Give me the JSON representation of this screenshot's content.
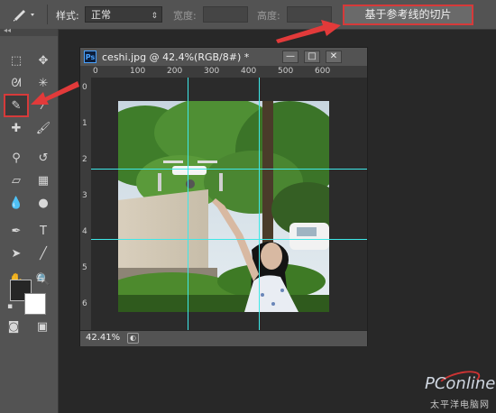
{
  "options_bar": {
    "style_label": "样式:",
    "style_value": "正常",
    "width_label": "宽度:",
    "height_label": "高度:",
    "slice_button_label": "基于参考线的切片"
  },
  "document": {
    "title": "ceshi.jpg @ 42.4%(RGB/8#) *",
    "ps_badge": "Ps",
    "zoom": "42.41%",
    "ruler_h_ticks": [
      "0",
      "100",
      "200",
      "300",
      "400",
      "500",
      "600"
    ],
    "ruler_v_ticks": [
      "0",
      "1",
      "2",
      "3",
      "4",
      "5",
      "6"
    ],
    "window_buttons": {
      "minimize": "—",
      "maximize": "□",
      "close": "✕"
    }
  },
  "toolbox": {
    "collapse_glyph": "◂◂",
    "tools": [
      {
        "name": "marquee-tool",
        "glyph": "⬚"
      },
      {
        "name": "move-tool",
        "glyph": "✥"
      },
      {
        "name": "lasso-tool",
        "glyph": "ᘛ"
      },
      {
        "name": "magic-wand-tool",
        "glyph": "✳"
      },
      {
        "name": "slice-tool",
        "glyph": "✎",
        "highlighted": true
      },
      {
        "name": "eyedropper-tool",
        "glyph": "⁄"
      },
      {
        "name": "healing-brush-tool",
        "glyph": "✚"
      },
      {
        "name": "brush-tool",
        "glyph": "🖌"
      },
      {
        "name": "clone-stamp-tool",
        "glyph": "⚲"
      },
      {
        "name": "history-brush-tool",
        "glyph": "↺"
      },
      {
        "name": "eraser-tool",
        "glyph": "▱"
      },
      {
        "name": "gradient-tool",
        "glyph": "▦"
      },
      {
        "name": "blur-tool",
        "glyph": "💧"
      },
      {
        "name": "dodge-tool",
        "glyph": "●"
      },
      {
        "name": "pen-tool",
        "glyph": "✒"
      },
      {
        "name": "type-tool",
        "glyph": "T"
      },
      {
        "name": "path-selection-tool",
        "glyph": "➤"
      },
      {
        "name": "line-tool",
        "glyph": "╱"
      },
      {
        "name": "hand-tool",
        "glyph": "✋"
      },
      {
        "name": "zoom-tool",
        "glyph": "🔍"
      }
    ]
  },
  "watermark": {
    "brand": "PConline",
    "tagline": "太平洋电脑网"
  },
  "colors": {
    "highlight": "#d63a3a",
    "guide": "#3ee8e8",
    "panel": "#535353",
    "workspace": "#282828"
  }
}
